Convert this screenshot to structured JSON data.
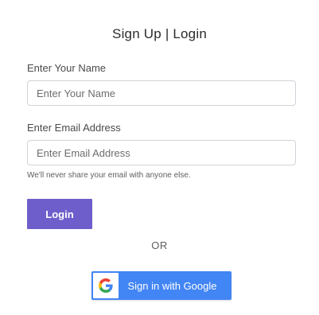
{
  "form": {
    "title": "Sign Up | Login",
    "name_label": "Enter Your Name",
    "name_placeholder": "Enter Your Name",
    "email_label": "Enter Email Address",
    "email_placeholder": "Enter Email Address",
    "email_help": "We'll never share your email with anyone else.",
    "login_label": "Login",
    "divider_text": "OR",
    "google_label": "Sign in with Google"
  },
  "colors": {
    "login_button": "#6e5ecb",
    "google_button": "#4285f4"
  },
  "icons": {
    "google": "google-g-icon"
  }
}
